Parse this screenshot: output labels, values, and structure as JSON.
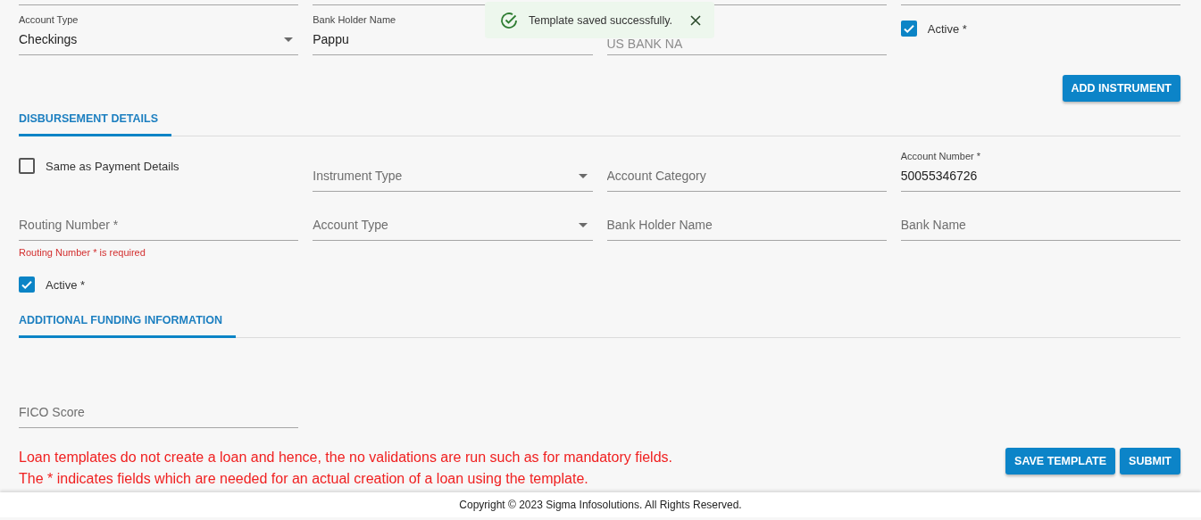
{
  "toast": {
    "message": "Template saved successfully."
  },
  "payment_row": {
    "fields": [
      {
        "kind": "select",
        "label": "Account Type",
        "value": "Checkings",
        "disabled": false
      },
      {
        "kind": "text",
        "label": "Bank Holder Name",
        "value": "Pappu",
        "disabled": false
      },
      {
        "kind": "text",
        "value": "US BANK NA",
        "disabled": true
      }
    ],
    "active": {
      "label": "Active *",
      "checked": true
    },
    "add_button": "ADD INSTRUMENT"
  },
  "disbursement": {
    "tab": {
      "label": "DISBURSEMENT DETAILS",
      "selected": true
    },
    "items": [
      {
        "kind": "checkbox",
        "label": "Same as Payment Details",
        "checked": false
      },
      {
        "kind": "select",
        "placeholder": "Instrument Type"
      },
      {
        "kind": "text",
        "placeholder": "Account Category"
      },
      {
        "kind": "text",
        "label": "Account Number *",
        "value": "50055346726"
      },
      {
        "kind": "text",
        "placeholder": "Routing Number *",
        "error": "Routing Number * is required"
      },
      {
        "kind": "select",
        "placeholder": "Account Type"
      },
      {
        "kind": "text",
        "placeholder": "Bank Holder Name"
      },
      {
        "kind": "text",
        "placeholder": "Bank Name"
      }
    ],
    "active": {
      "label": "Active *",
      "checked": true
    }
  },
  "additional_funding": {
    "tab": {
      "label": "ADDITIONAL FUNDING INFORMATION",
      "selected": true
    },
    "fields": [
      {
        "kind": "text",
        "placeholder": "FICO Score"
      }
    ]
  },
  "notes": [
    "Loan templates do not create a loan and hence, the no validations are run such as for mandatory fields.",
    "The * indicates fields which are needed for an actual creation of a loan using the template."
  ],
  "buttons": [
    "SAVE TEMPLATE",
    "SUBMIT"
  ],
  "footer": "Copyright © 2023 Sigma Infosolutions. All Rights Reserved."
}
